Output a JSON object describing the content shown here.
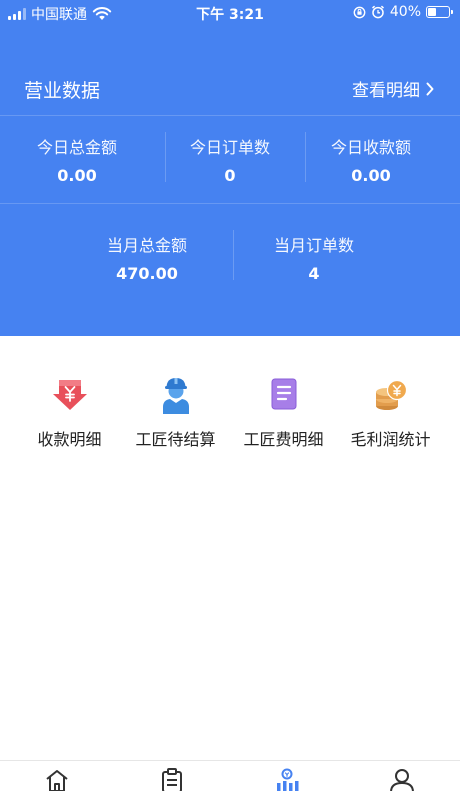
{
  "status_bar": {
    "carrier": "中国联通",
    "time": "下午 3:21",
    "battery": "40%",
    "battery_level": 0.4
  },
  "header": {
    "title": "营业数据",
    "view_detail": "查看明细"
  },
  "today": [
    {
      "label": "今日总金额",
      "value": "0.00"
    },
    {
      "label": "今日订单数",
      "value": "0"
    },
    {
      "label": "今日收款额",
      "value": "0.00"
    }
  ],
  "month": [
    {
      "label": "当月总金额",
      "value": "470.00"
    },
    {
      "label": "当月订单数",
      "value": "4"
    }
  ],
  "quick_actions": [
    {
      "label": "收款明细",
      "icon": "red-arrow-yen-icon"
    },
    {
      "label": "工匠待结算",
      "icon": "worker-icon"
    },
    {
      "label": "工匠费明细",
      "icon": "document-icon"
    },
    {
      "label": "毛利润统计",
      "icon": "coins-yen-icon"
    }
  ],
  "tabbar": [
    {
      "icon": "home-icon",
      "active": false
    },
    {
      "icon": "list-icon",
      "active": false
    },
    {
      "icon": "stats-icon",
      "active": true
    },
    {
      "icon": "user-icon",
      "active": false
    }
  ],
  "colors": {
    "primary": "#4682f1",
    "active_tab": "#4682f1",
    "inactive_tab": "#333333"
  }
}
